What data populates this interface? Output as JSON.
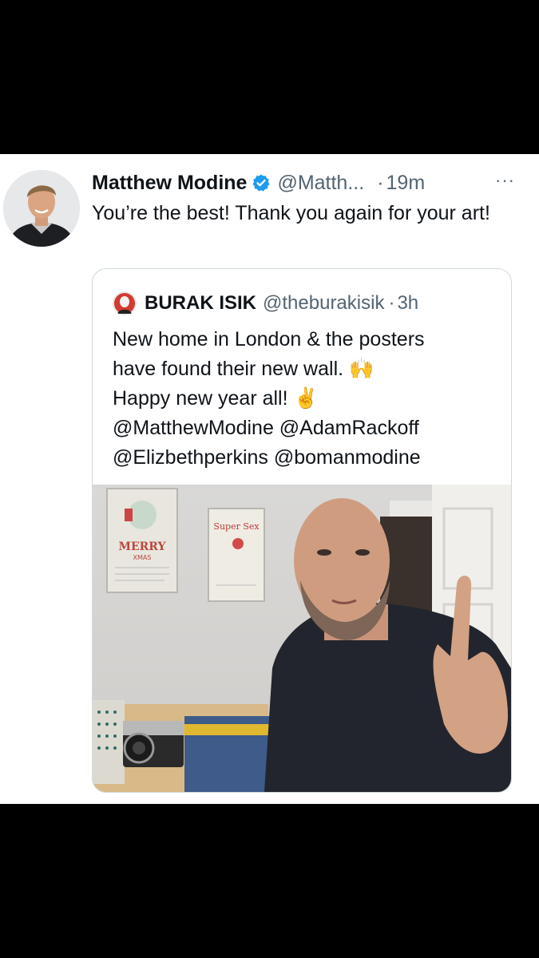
{
  "tweet": {
    "author_name": "Matthew Modine",
    "author_handle": "@Matth...",
    "separator": "·",
    "time": "19m",
    "more": "···",
    "text": "You’re the best! Thank you again for your art!",
    "verified_icon": "verified-badge-icon",
    "avatar": "author-avatar"
  },
  "quote": {
    "author_name": "BURAK ISIK",
    "author_handle": "@theburakisik",
    "separator": "·",
    "time": "3h",
    "lines": [
      "New home in London & the posters",
      "have found their new wall. 🙌",
      "Happy new year all! ✌️",
      "@MatthewModine @AdamRackoff",
      "@Elizbethperkins @bomanmodine"
    ],
    "photo": {
      "poster_left_title": "MERRY",
      "poster_left_subtitle": "XMAS",
      "poster_right_title": "Super Sex"
    }
  },
  "colors": {
    "background": "#000000",
    "card": "#ffffff",
    "text": "#0f1419",
    "secondary_text": "#536471",
    "border": "#cfd9de",
    "verified_blue": "#1d9bf0"
  }
}
